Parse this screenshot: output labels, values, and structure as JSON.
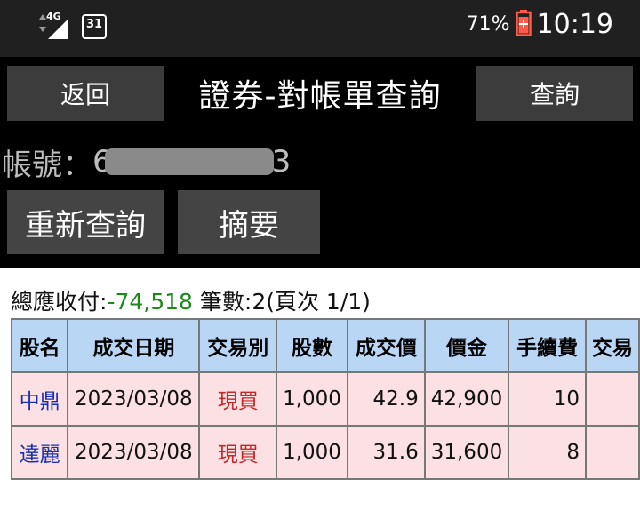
{
  "status": {
    "network": "4G",
    "calendar_day": "31",
    "battery": "71%",
    "time": "10:19"
  },
  "header": {
    "back_label": "返回",
    "title": "證券-對帳單查詢",
    "query_label": "查詢"
  },
  "account": {
    "label": "帳號：",
    "prefix": "6",
    "suffix": "3"
  },
  "actions": {
    "requery_label": "重新查詢",
    "summary_label": "摘要"
  },
  "summary": {
    "total_label": "總應收付:",
    "total_value": "-74,518",
    "count_text": "筆數:2(頁次 1/1)"
  },
  "table": {
    "columns": [
      "股名",
      "成交日期",
      "交易別",
      "股數",
      "成交價",
      "價金",
      "手續費",
      "交易"
    ],
    "rows": [
      {
        "name": "中鼎",
        "date": "2023/03/08",
        "type": "現買",
        "shares": "1,000",
        "price": "42.9",
        "amount": "42,900",
        "fee": "10",
        "tax": ""
      },
      {
        "name": "達麗",
        "date": "2023/03/08",
        "type": "現買",
        "shares": "1,000",
        "price": "31.6",
        "amount": "31,600",
        "fee": "8",
        "tax": ""
      }
    ]
  }
}
